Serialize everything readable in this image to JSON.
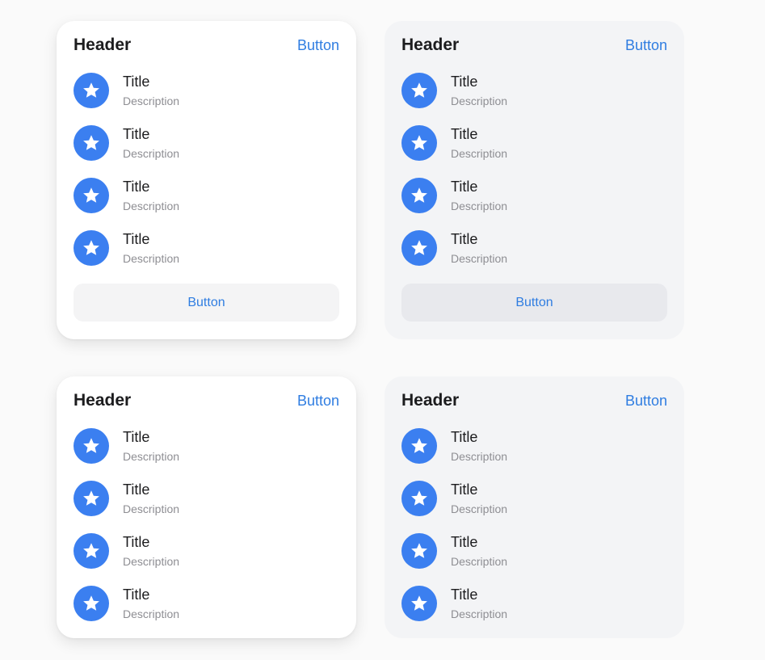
{
  "colors": {
    "accent": "#2f7de1",
    "avatar": "#3b7ff0",
    "white_card": "#ffffff",
    "gray_card": "#f3f4f6"
  },
  "cards": [
    {
      "header": "Header",
      "header_button": "Button",
      "items": [
        {
          "title": "Title",
          "description": "Description",
          "icon": "star-icon"
        },
        {
          "title": "Title",
          "description": "Description",
          "icon": "star-icon"
        },
        {
          "title": "Title",
          "description": "Description",
          "icon": "star-icon"
        },
        {
          "title": "Title",
          "description": "Description",
          "icon": "star-icon"
        }
      ],
      "footer_button": "Button"
    },
    {
      "header": "Header",
      "header_button": "Button",
      "items": [
        {
          "title": "Title",
          "description": "Description",
          "icon": "star-icon"
        },
        {
          "title": "Title",
          "description": "Description",
          "icon": "star-icon"
        },
        {
          "title": "Title",
          "description": "Description",
          "icon": "star-icon"
        },
        {
          "title": "Title",
          "description": "Description",
          "icon": "star-icon"
        }
      ],
      "footer_button": "Button"
    },
    {
      "header": "Header",
      "header_button": "Button",
      "items": [
        {
          "title": "Title",
          "description": "Description",
          "icon": "star-icon"
        },
        {
          "title": "Title",
          "description": "Description",
          "icon": "star-icon"
        },
        {
          "title": "Title",
          "description": "Description",
          "icon": "star-icon"
        },
        {
          "title": "Title",
          "description": "Description",
          "icon": "star-icon"
        }
      ]
    },
    {
      "header": "Header",
      "header_button": "Button",
      "items": [
        {
          "title": "Title",
          "description": "Description",
          "icon": "star-icon"
        },
        {
          "title": "Title",
          "description": "Description",
          "icon": "star-icon"
        },
        {
          "title": "Title",
          "description": "Description",
          "icon": "star-icon"
        },
        {
          "title": "Title",
          "description": "Description",
          "icon": "star-icon"
        }
      ]
    }
  ]
}
